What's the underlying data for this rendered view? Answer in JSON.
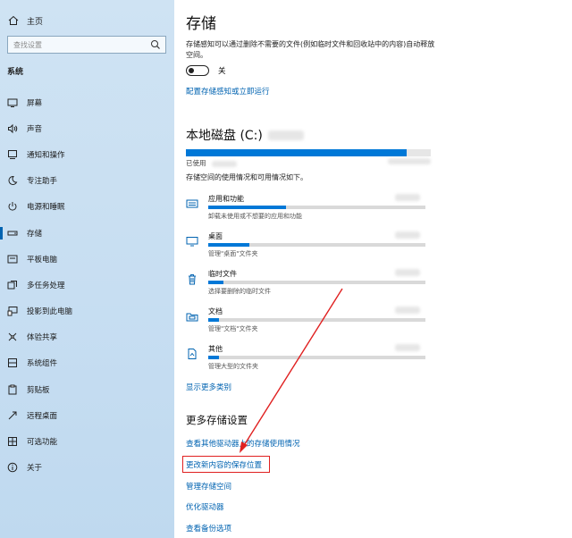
{
  "sidebar": {
    "home_label": "主页",
    "search_placeholder": "查找设置",
    "section_label": "系统",
    "items": [
      {
        "label": "屏幕",
        "icon": "display-icon"
      },
      {
        "label": "声音",
        "icon": "speaker-icon"
      },
      {
        "label": "通知和操作",
        "icon": "notification-icon"
      },
      {
        "label": "专注助手",
        "icon": "moon-icon"
      },
      {
        "label": "电源和睡眠",
        "icon": "power-icon"
      },
      {
        "label": "存储",
        "icon": "storage-icon",
        "active": true
      },
      {
        "label": "平板电脑",
        "icon": "tablet-icon"
      },
      {
        "label": "多任务处理",
        "icon": "multitask-icon"
      },
      {
        "label": "投影到此电脑",
        "icon": "project-icon"
      },
      {
        "label": "体验共享",
        "icon": "share-icon"
      },
      {
        "label": "系统组件",
        "icon": "components-icon"
      },
      {
        "label": "剪贴板",
        "icon": "clipboard-icon"
      },
      {
        "label": "远程桌面",
        "icon": "remote-icon"
      },
      {
        "label": "可选功能",
        "icon": "optional-features-icon"
      },
      {
        "label": "关于",
        "icon": "info-icon"
      }
    ]
  },
  "main": {
    "title": "存储",
    "description": "存储感知可以通过删除不需要的文件(例如临时文件和回收站中的内容)自动释放空间。",
    "toggle_state": "关",
    "configure_link": "配置存储感知或立即运行",
    "disk_title": "本地磁盘 (C:)",
    "disk_used_fraction": 0.9,
    "used_label": "已使用",
    "usage_desc": "存储空间的使用情况和可用情况如下。",
    "categories": [
      {
        "name": "应用和功能",
        "sub": "卸载未使用或不想要的应用和功能",
        "fill": 0.36,
        "icon": "apps-icon"
      },
      {
        "name": "桌面",
        "sub": "管理\"桌面\"文件夹",
        "fill": 0.19,
        "icon": "desktop-icon"
      },
      {
        "name": "临时文件",
        "sub": "选择要删除的临时文件",
        "fill": 0.07,
        "icon": "trash-icon"
      },
      {
        "name": "文档",
        "sub": "管理\"文档\"文件夹",
        "fill": 0.05,
        "icon": "documents-icon"
      },
      {
        "name": "其他",
        "sub": "管理大型的文件夹",
        "fill": 0.05,
        "icon": "other-icon"
      }
    ],
    "more_categories_link": "显示更多类别",
    "more_settings_title": "更多存储设置",
    "more_links": [
      "查看其他驱动器上的存储使用情况",
      "更改新内容的保存位置",
      "管理存储空间",
      "优化驱动器",
      "查看备份选项"
    ]
  },
  "colors": {
    "accent": "#0063b1",
    "bar": "#0078d7",
    "annotation": "#e02020"
  }
}
